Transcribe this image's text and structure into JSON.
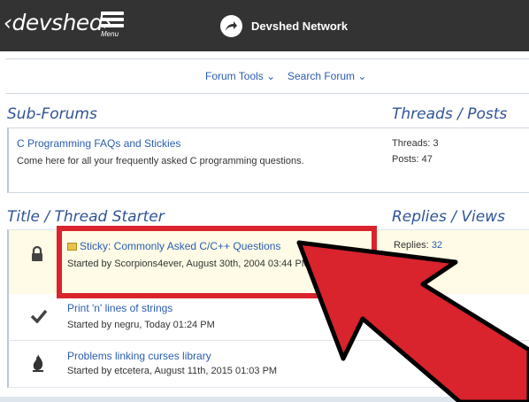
{
  "topbar": {
    "logo": "‹devshed›",
    "menu_label": "Menu",
    "network_label": "Devshed Network"
  },
  "tools": {
    "forum_tools": "Forum Tools ⌄",
    "search_forum": "Search Forum ⌄"
  },
  "subforums": {
    "heading": "Sub-Forums",
    "stats_heading": "Threads / Posts",
    "item": {
      "title": "C Programming FAQs and Stickies",
      "description": "Come here for all your frequently asked C programming questions.",
      "threads": "Threads: 3",
      "posts": "Posts: 47"
    }
  },
  "threads": {
    "heading": "Title / Thread Starter",
    "stats_heading": "Replies / Views",
    "items": [
      {
        "title": "Sticky: Commonly Asked C/C++ Questions",
        "starter": "Started by Scorpions4ever, August 30th, 2004 03:44 PM",
        "replies_label": "Replies:",
        "replies_value": "32",
        "icon": "lock-icon"
      },
      {
        "title": "Print 'n' lines of strings",
        "starter": "Started by negru, Today 01:24 PM",
        "icon": "checkmark-icon"
      },
      {
        "title": "Problems linking curses library",
        "starter": "Started by etcetera, August 11th, 2015 01:03 PM",
        "icon": "flame-icon"
      }
    ]
  },
  "colors": {
    "accent": "#2a5db0",
    "topbar": "#333333",
    "highlight_box": "#d9232d",
    "arrow": "#d9232d"
  }
}
